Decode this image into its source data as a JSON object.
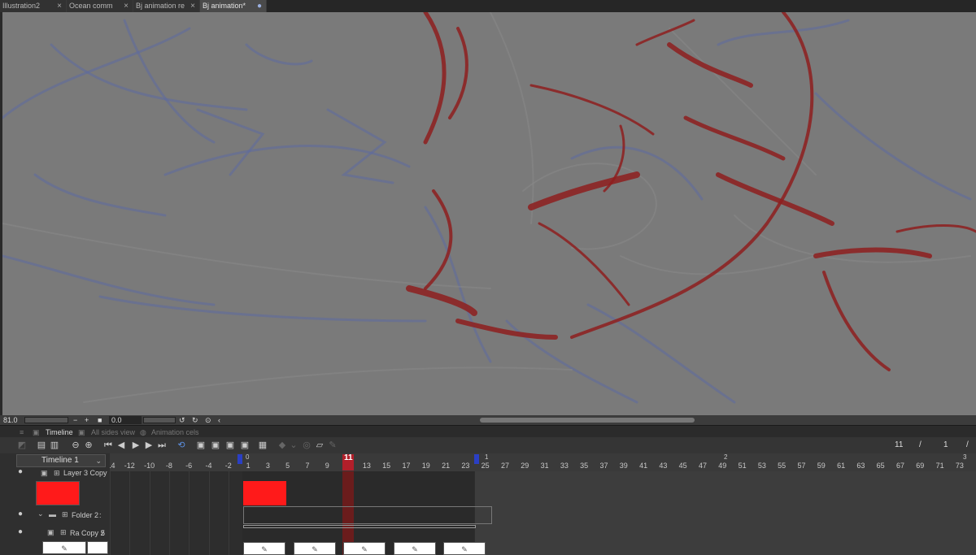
{
  "tabs": [
    {
      "label": "Illustration2",
      "close": "×"
    },
    {
      "label": "Ocean comm",
      "close": "×"
    },
    {
      "label": "Bj animation re",
      "close": "×"
    },
    {
      "label": "Bj animation*",
      "close": "●"
    }
  ],
  "canvas_status": {
    "zoom": "81.0",
    "zoom_minus": "−",
    "zoom_plus": "+",
    "angle": "0.0"
  },
  "panel_tabs": {
    "timeline": "Timeline",
    "all_sides_view": "All sides view",
    "animation_cels": "Animation cels"
  },
  "frame_info": {
    "current": "11",
    "sep1": "/",
    "second": "1",
    "sep2": "/"
  },
  "timeline_select": {
    "value": "Timeline 1"
  },
  "layers": [
    {
      "name": "Layer 3 Copy"
    },
    {
      "name": "Folder 2",
      "suffix": ":"
    },
    {
      "name": "Ra Copy 2",
      "suffix": "5"
    }
  ],
  "ruler": {
    "labels": [
      "-14",
      "-12",
      "-10",
      "-8",
      "-6",
      "-4",
      "-2",
      "1",
      "3",
      "5",
      "7",
      "9",
      "11",
      "13",
      "15",
      "17",
      "19",
      "21",
      "23",
      "25",
      "27",
      "29",
      "31",
      "33",
      "35",
      "37",
      "39",
      "41",
      "43",
      "45",
      "47",
      "49",
      "51",
      "53",
      "55",
      "57",
      "59",
      "61",
      "63",
      "65",
      "67",
      "69",
      "71",
      "73"
    ],
    "seconds": [
      "0",
      "1",
      "2",
      "3"
    ],
    "current_frame": "11"
  },
  "colors": {
    "canvas": "#7a7a7a",
    "red_cel": "#ff1a1a",
    "playhead": "#b21f2a",
    "range_marker": "#2a3fc4",
    "accent": "#5b8fe0"
  }
}
